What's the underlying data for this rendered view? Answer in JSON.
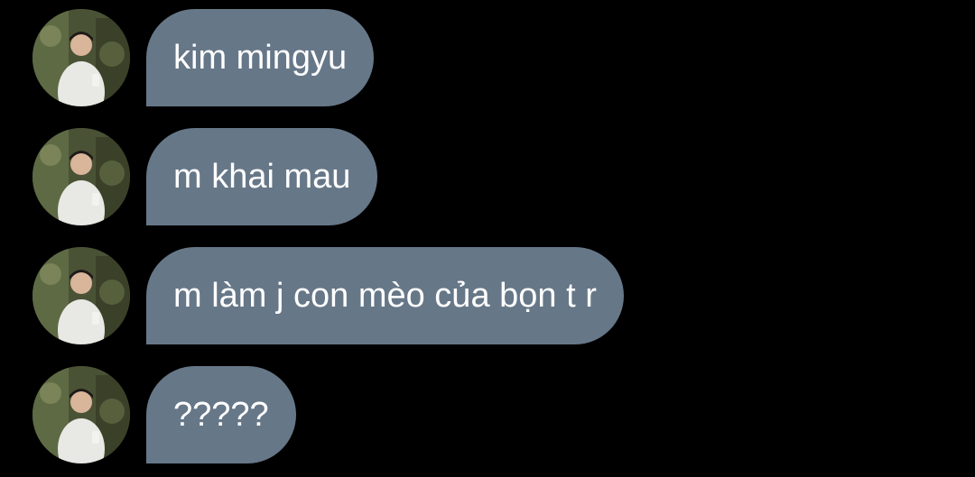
{
  "colors": {
    "background": "#000000",
    "bubble": "#667788",
    "text": "#ffffff"
  },
  "messages": [
    {
      "text": "kim mingyu",
      "avatar": "profile-photo-icon"
    },
    {
      "text": "m khai mau",
      "avatar": "profile-photo-icon"
    },
    {
      "text": "m làm j con mèo của bọn t r",
      "avatar": "profile-photo-icon"
    },
    {
      "text": "?????",
      "avatar": "profile-photo-icon"
    }
  ]
}
